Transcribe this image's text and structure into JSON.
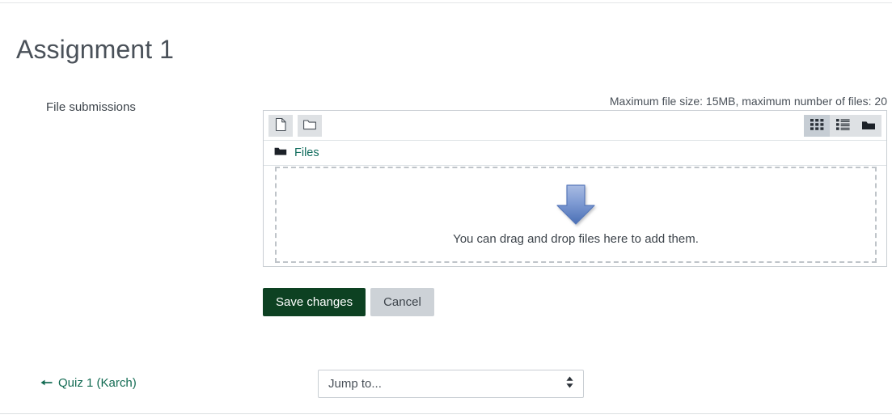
{
  "page": {
    "title": "Assignment 1"
  },
  "form": {
    "field_label": "File submissions",
    "max_size_note": "Maximum file size: 15MB, maximum number of files: 20"
  },
  "filemanager": {
    "toolbar": {
      "add_file_icon": "file-icon",
      "create_folder_icon": "folder-icon",
      "view_icons": [
        {
          "name": "grid-view-icon",
          "active": true
        },
        {
          "name": "list-view-icon",
          "active": false
        },
        {
          "name": "tree-view-icon",
          "active": false
        }
      ]
    },
    "breadcrumb": {
      "icon": "folder-icon",
      "label": "Files"
    },
    "dropzone": {
      "icon": "down-arrow-icon",
      "text": "You can drag and drop files here to add them."
    }
  },
  "buttons": {
    "save_label": "Save changes",
    "cancel_label": "Cancel"
  },
  "bottom_nav": {
    "prev_icon": "left-arrow-icon",
    "prev_label": "Quiz 1 (Karch)",
    "jump_to_selected": "Jump to...",
    "jump_to_options": [
      "Jump to..."
    ],
    "jump_to_chevron_icon": "chevron-up-down-icon"
  },
  "colors": {
    "primary_button": "#0d4122",
    "secondary_button": "#cdd2d7",
    "link": "#136b53",
    "arrow_top": "#9db1dd",
    "arrow_bottom": "#4a6fb5"
  }
}
